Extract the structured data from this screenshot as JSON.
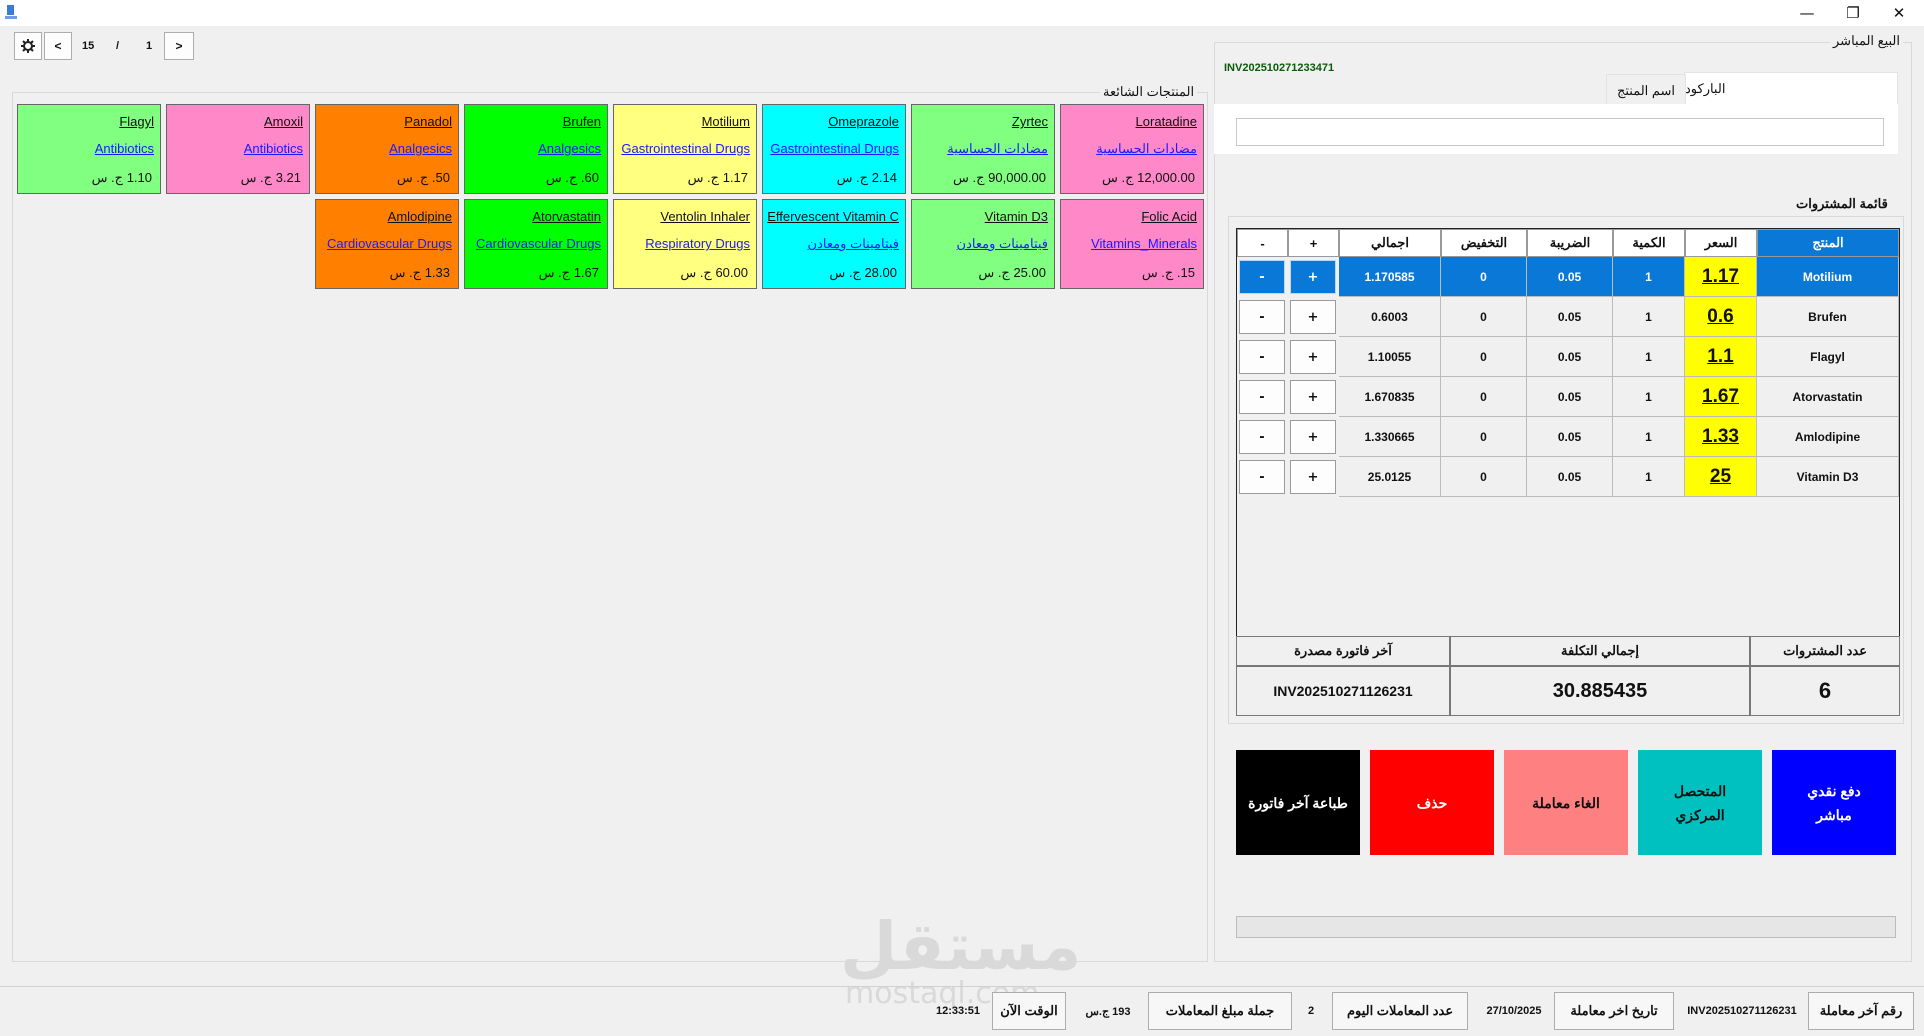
{
  "window": {
    "minimize": "—",
    "restore": "❐",
    "close": "✕"
  },
  "pager": {
    "settings_icon": "gear-icon",
    "prev": "<",
    "total": "15",
    "separator": "/",
    "current": "1",
    "next": ">"
  },
  "left_group": {
    "title": "المنتجات الشائعة"
  },
  "products": [
    {
      "name": "Loratadine",
      "category": "مضادات الحساسية",
      "price": "12,000.00 ج. س",
      "color": "#ff88c8"
    },
    {
      "name": "Zyrtec",
      "category": "مضادات الحساسية",
      "price": "90,000.00 ج. س",
      "color": "#80ff80"
    },
    {
      "name": "Omeprazole",
      "category": "Gastrointestinal Drugs",
      "price": "2.14 ج. س",
      "color": "#00ffff"
    },
    {
      "name": "Motilium",
      "category": "Gastrointestinal Drugs",
      "price": "1.17 ج. س",
      "color": "#ffff80"
    },
    {
      "name": "Brufen",
      "category": "Analgesics",
      "price": "60. ج. س",
      "color": "#00ff00"
    },
    {
      "name": "Panadol",
      "category": "Analgesics",
      "price": "50. ج. س",
      "color": "#ff8000"
    },
    {
      "name": "Amoxil",
      "category": "Antibiotics",
      "price": "3.21 ج. س",
      "color": "#ff88c8"
    },
    {
      "name": "Flagyl",
      "category": "Antibiotics",
      "price": "1.10 ج. س",
      "color": "#80ff80"
    },
    {
      "name": "Folic Acid",
      "category": "Vitamins_Minerals",
      "price": "15. ج. س",
      "color": "#ff88c8"
    },
    {
      "name": "Vitamin D3",
      "category": "فيتامينات ومعادن",
      "price": "25.00 ج. س",
      "color": "#80ff80"
    },
    {
      "name": "Effervescent Vitamin C",
      "category": "فيتامينات ومعادن",
      "price": "28.00 ج. س",
      "color": "#00ffff"
    },
    {
      "name": "Ventolin Inhaler",
      "category": "Respiratory Drugs",
      "price": "60.00 ج. س",
      "color": "#ffff80"
    },
    {
      "name": "Atorvastatin",
      "category": "Cardiovascular Drugs",
      "price": "1.67 ج. س",
      "color": "#00ff00"
    },
    {
      "name": "Amlodipine",
      "category": "Cardiovascular Drugs",
      "price": "1.33 ج. س",
      "color": "#ff8000"
    }
  ],
  "right_group": {
    "title": "البيع المباشر",
    "invoice_no": "INV202510271233471"
  },
  "tabs": {
    "barcode": "الباركود",
    "product_name": "اسم المنتج"
  },
  "search": {
    "value": ""
  },
  "cart": {
    "title": "قائمة المشتروات",
    "headers": {
      "product": "المنتج",
      "price": "السعر",
      "qty": "الكمية",
      "tax": "الضريبة",
      "discount": "التخفيض",
      "total": "اجمالي",
      "plus": "+",
      "minus": "-"
    },
    "rows": [
      {
        "product": "Motilium",
        "price": "1.17",
        "qty": "1",
        "tax": "0.05",
        "discount": "0",
        "total": "1.170585",
        "plus": "+",
        "minus": "-"
      },
      {
        "product": "Brufen",
        "price": "0.6",
        "qty": "1",
        "tax": "0.05",
        "discount": "0",
        "total": "0.6003",
        "plus": "+",
        "minus": "-"
      },
      {
        "product": "Flagyl",
        "price": "1.1",
        "qty": "1",
        "tax": "0.05",
        "discount": "0",
        "total": "1.10055",
        "plus": "+",
        "minus": "-"
      },
      {
        "product": "Atorvastatin",
        "price": "1.67",
        "qty": "1",
        "tax": "0.05",
        "discount": "0",
        "total": "1.670835",
        "plus": "+",
        "minus": "-"
      },
      {
        "product": "Amlodipine",
        "price": "1.33",
        "qty": "1",
        "tax": "0.05",
        "discount": "0",
        "total": "1.330665",
        "plus": "+",
        "minus": "-"
      },
      {
        "product": "Vitamin D3",
        "price": "25",
        "qty": "1",
        "tax": "0.05",
        "discount": "0",
        "total": "25.0125",
        "plus": "+",
        "minus": "-"
      }
    ]
  },
  "summary": {
    "count_label": "عدد المشتروات",
    "count_value": "6",
    "total_label": "إجمالي التكلفة",
    "total_value": "30.885435",
    "last_invoice_label": "آخر فاتورة مصدرة",
    "last_invoice_value": "INV202510271126231"
  },
  "actions": {
    "cash_line1": "دفع نقدي",
    "cash_line2": "مباشر",
    "central_line1": "المتحصل",
    "central_line2": "المركزي",
    "cancel": "الغاء معاملة",
    "delete": "حذف",
    "print": "طباعة آخر فاتورة"
  },
  "statusbar": {
    "last_txn_label": "رقم آخر معاملة",
    "last_txn_value": "INV202510271126231",
    "last_date_label": "تاريخ اخر معاملة",
    "last_date_value": "27/10/2025",
    "today_count_label": "عدد المعاملات اليوم",
    "today_count_value": "2",
    "total_amount_label": "جملة مبلغ المعاملات",
    "total_amount_value": "193 ج.س",
    "now_label": "الوقت الآن",
    "now_value": "12:33:51"
  },
  "watermark": {
    "main": "مستقل",
    "sub": "mostaql.com"
  },
  "colors": {
    "selected_row": "#0a78d7",
    "price_highlight": "#ffff00",
    "cash": "#0000ff",
    "central": "#00c0c0",
    "cancel": "#ff8080",
    "delete": "#ff0000",
    "print": "#000000"
  }
}
